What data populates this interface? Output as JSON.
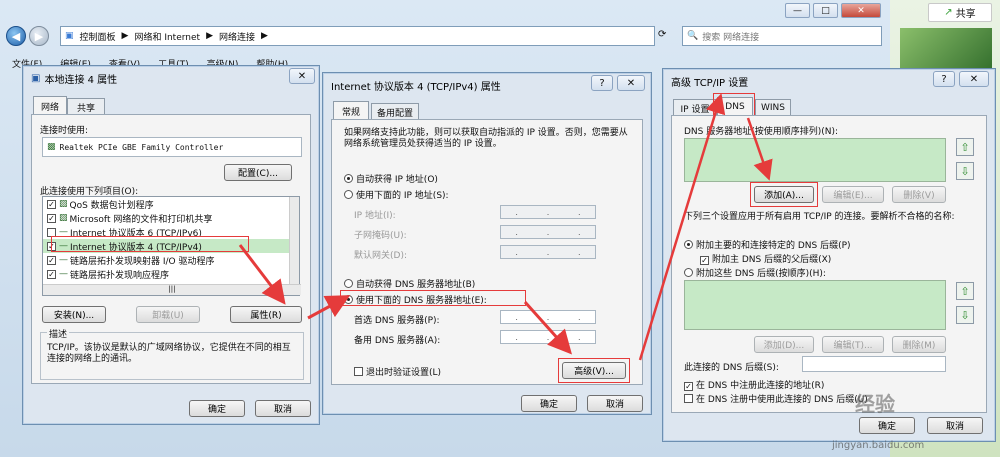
{
  "explorer": {
    "breadcrumb": [
      "控制面板",
      "网络和 Internet",
      "网络连接"
    ],
    "search_placeholder": "搜索 网络连接",
    "menu": [
      "文件(F)",
      "编辑(E)",
      "查看(V)",
      "工具(T)",
      "高级(N)",
      "帮助(H)"
    ],
    "share_label": "共享"
  },
  "dlg1": {
    "title": "本地连接 4 属性",
    "tabs": [
      "网络",
      "共享"
    ],
    "connect_using_label": "连接时使用:",
    "adapter": "Realtek PCIe GBE Family Controller",
    "configure_button": "配置(C)...",
    "items_label": "此连接使用下列项目(O):",
    "items": [
      {
        "label": "QoS 数据包计划程序",
        "checked": true
      },
      {
        "label": "Microsoft 网络的文件和打印机共享",
        "checked": true
      },
      {
        "label": "Internet 协议版本 6 (TCP/IPv6)",
        "checked": false
      },
      {
        "label": "Internet 协议版本 4 (TCP/IPv4)",
        "checked": true
      },
      {
        "label": "链路层拓扑发现映射器 I/O 驱动程序",
        "checked": true
      },
      {
        "label": "链路层拓扑发现响应程序",
        "checked": true
      }
    ],
    "install_button": "安装(N)...",
    "uninstall_button": "卸载(U)",
    "properties_button": "属性(R)",
    "desc_label": "描述",
    "description": "TCP/IP。该协议是默认的广域网络协议，它提供在不同的相互连接的网络上的通讯。",
    "ok_button": "确定",
    "cancel_button": "取消"
  },
  "dlg2": {
    "title": "Internet 协议版本 4 (TCP/IPv4) 属性",
    "tabs": [
      "常规",
      "备用配置"
    ],
    "intro": "如果网络支持此功能，则可以获取自动指派的 IP 设置。否则，您需要从网络系统管理员处获得适当的 IP 设置。",
    "auto_ip": "自动获得 IP 地址(O)",
    "manual_ip": "使用下面的 IP 地址(S):",
    "ip_label": "IP 地址(I):",
    "mask_label": "子网掩码(U):",
    "gateway_label": "默认网关(D):",
    "auto_dns": "自动获得 DNS 服务器地址(B)",
    "manual_dns": "使用下面的 DNS 服务器地址(E):",
    "pref_dns_label": "首选 DNS 服务器(P):",
    "alt_dns_label": "备用 DNS 服务器(A):",
    "validate_label": "退出时验证设置(L)",
    "advanced_button": "高级(V)...",
    "ok_button": "确定",
    "cancel_button": "取消"
  },
  "dlg3": {
    "title": "高级 TCP/IP 设置",
    "tabs": [
      "IP 设置",
      "DNS",
      "WINS"
    ],
    "dns_servers_label": "DNS 服务器地址(按使用顺序排列)(N):",
    "add_button": "添加(A)...",
    "edit_button": "编辑(E)...",
    "delete_button": "删除(V)",
    "resolve_label": "下列三个设置应用于所有启用 TCP/IP 的连接。要解析不合格的名称:",
    "append_primary": "附加主要的和连接特定的 DNS 后缀(P)",
    "append_parent": "附加主 DNS 后缀的父后缀(X)",
    "append_these": "附加这些 DNS 后缀(按顺序)(H):",
    "add2_button": "添加(D)...",
    "edit2_button": "编辑(T)...",
    "delete2_button": "删除(M)",
    "suffix_label": "此连接的 DNS 后缀(S):",
    "register_label": "在 DNS 中注册此连接的地址(R)",
    "use_suffix_label": "在 DNS 注册中使用此连接的 DNS 后缀(U)",
    "ok_button": "确定",
    "cancel_button": "取消"
  },
  "watermark": {
    "text": "经验",
    "url": "jingyan.baidu.com"
  }
}
